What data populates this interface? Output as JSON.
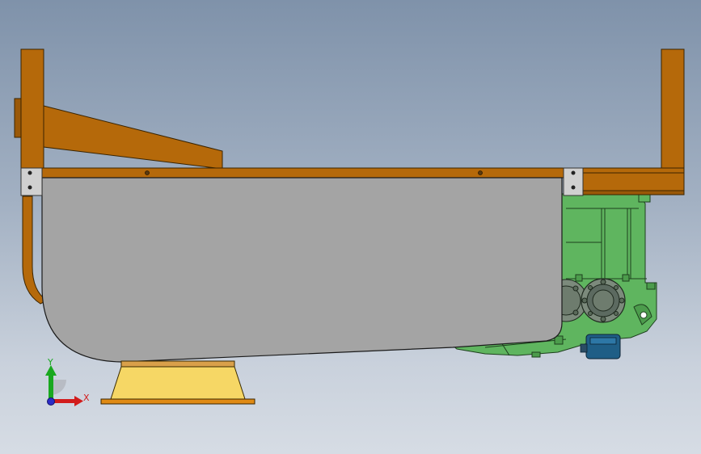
{
  "triad": {
    "y_label": "Y",
    "x_label": "X",
    "y_color": "#19a81f",
    "x_color": "#d21c1c",
    "z_color": "#2c2cc8"
  },
  "colors": {
    "frame_wood": "#b5690a",
    "frame_edge": "#3a2400",
    "trough_gray": "#a4a4a4",
    "gearbox_green": "#5fb55f",
    "motor_blue": "#1f5e86",
    "hopper_yellow": "#f6d765",
    "bracket_light": "#c8c8c8"
  }
}
